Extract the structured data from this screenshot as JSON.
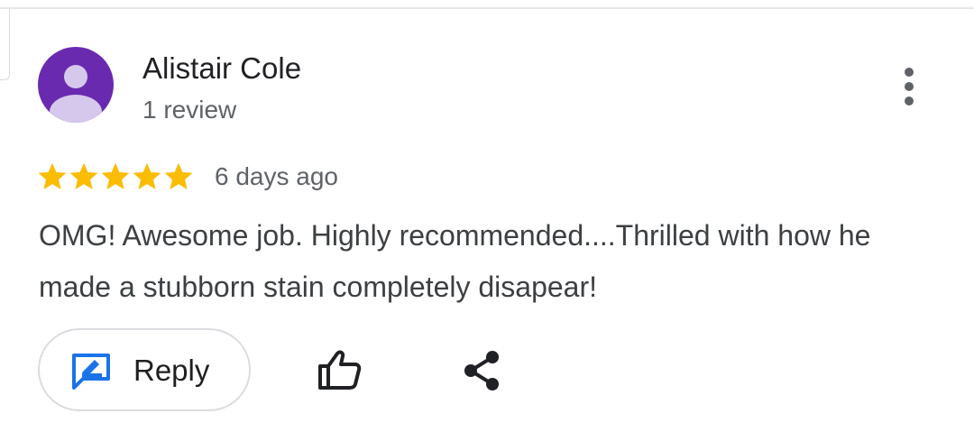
{
  "review": {
    "author_name": "Alistair Cole",
    "review_count": "1 review",
    "rating": 5,
    "rating_max": 5,
    "date": "6 days ago",
    "text": "OMG! Awesome job. Highly recommended....Thrilled with how he made a stubborn stain completely disapear!"
  },
  "actions": {
    "reply_label": "Reply",
    "reply_icon": "reply-edit-icon",
    "like_icon": "thumbs-up-icon",
    "share_icon": "share-icon",
    "more_icon": "more-vertical-icon"
  },
  "colors": {
    "avatar_bg": "#6a2ab0",
    "avatar_fg": "#d6c8ec",
    "star": "#fbbc04",
    "accent_blue": "#1a73e8",
    "text_primary": "#202124",
    "text_secondary": "#5f6368"
  }
}
